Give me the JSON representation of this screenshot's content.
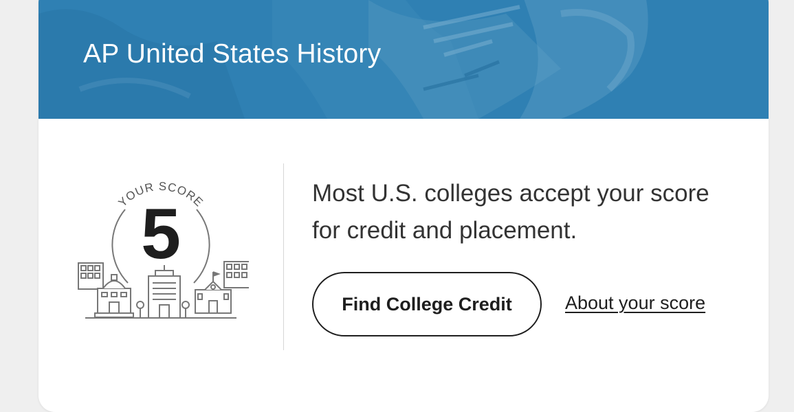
{
  "card": {
    "title": "AP United States History",
    "banner_color": "#2f80b3"
  },
  "score": {
    "label": "YOUR SCORE",
    "value": "5"
  },
  "message": "Most U.S. colleges accept your score for credit and placement.",
  "actions": {
    "primary_label": "Find College Credit",
    "link_label": "About your score"
  }
}
